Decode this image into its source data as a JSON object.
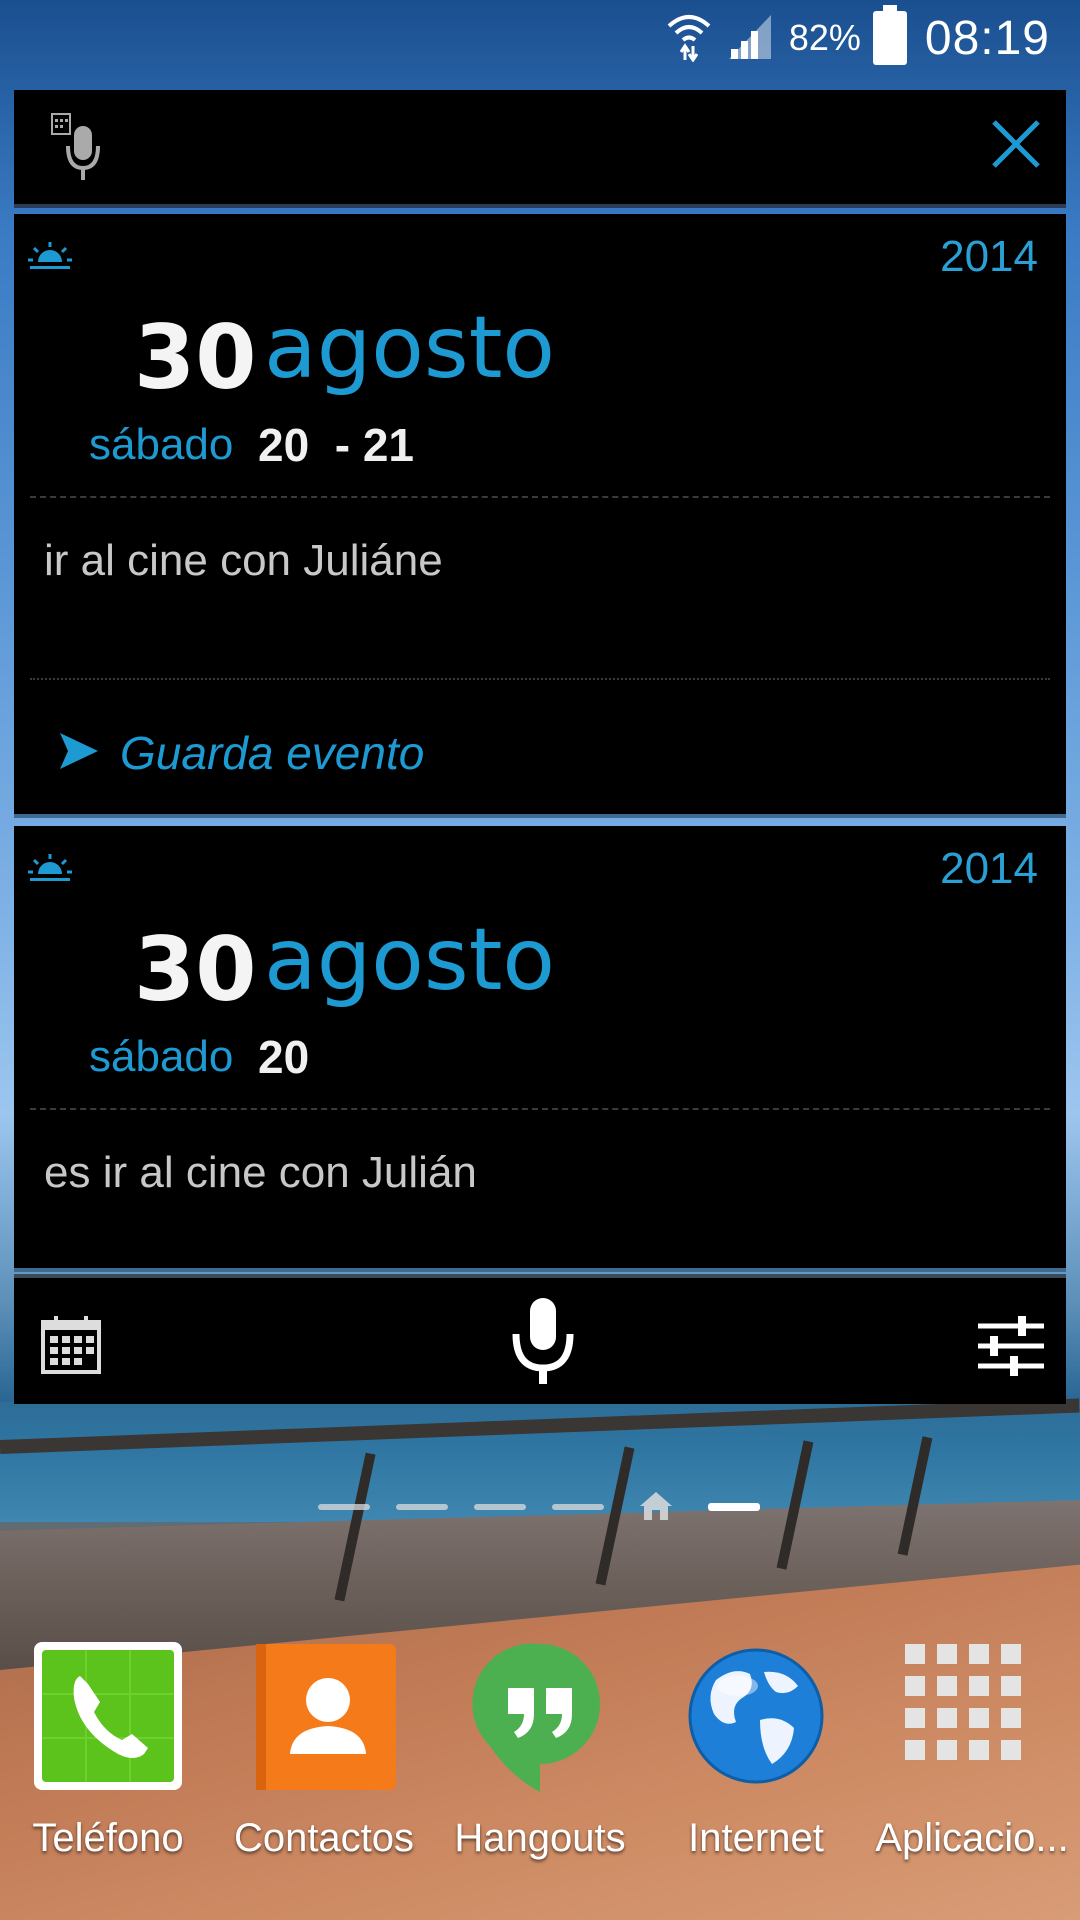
{
  "status_bar": {
    "battery_percent": "82%",
    "time": "08:19"
  },
  "widget": {
    "cards": [
      {
        "year": "2014",
        "day": "30",
        "month": "agosto",
        "weekday": "sábado",
        "hours": "20  - 21",
        "event_text": "ir al cine con Juliáne",
        "save_label": "Guarda evento"
      },
      {
        "year": "2014",
        "day": "30",
        "month": "agosto",
        "weekday": "sábado",
        "hours": "20",
        "event_text": "es ir al cine con Julián"
      }
    ]
  },
  "pager": {
    "pages": 6,
    "home_index": 4,
    "active_index": 5
  },
  "dock": {
    "apps": [
      {
        "label": "Teléfono",
        "icon": "phone-icon"
      },
      {
        "label": "Contactos",
        "icon": "contacts-icon"
      },
      {
        "label": "Hangouts",
        "icon": "hangouts-icon"
      },
      {
        "label": "Internet",
        "icon": "globe-icon"
      },
      {
        "label": "Aplicacio...",
        "icon": "apps-grid-icon"
      }
    ]
  },
  "colors": {
    "accent": "#1e9ad3",
    "phone_green": "#5cc21c",
    "contacts_orange": "#f47a1a",
    "hangouts_green": "#4caf50"
  }
}
